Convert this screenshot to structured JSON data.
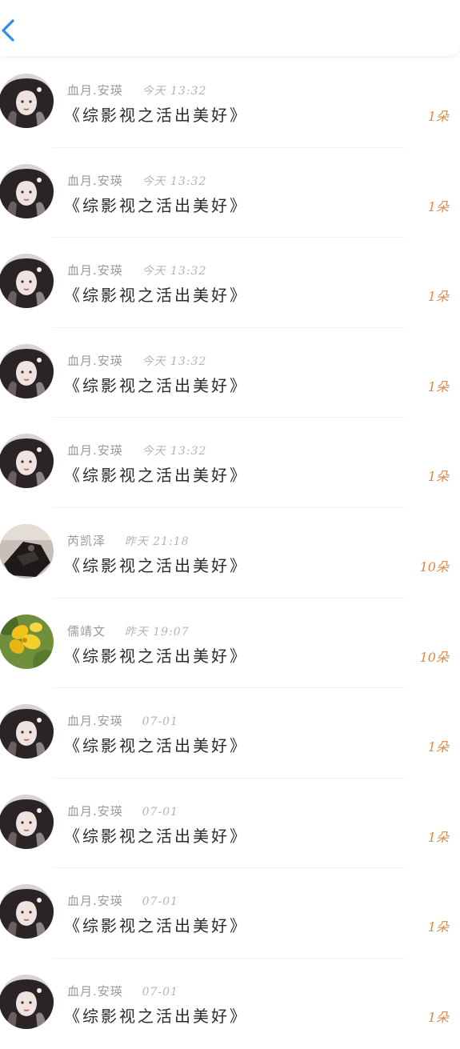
{
  "header": {
    "back_icon": "chevron-left-icon",
    "accent": "#2d8cf0"
  },
  "colors": {
    "count": "#d98a4a",
    "title": "#2b2b2b",
    "meta": "#9a9a9a"
  },
  "rows": [
    {
      "user": "血月.安瑛",
      "time": "今天 13:32",
      "title": "《综影视之活出美好》",
      "count": "1朵",
      "avatar": "dark-hair-girl"
    },
    {
      "user": "血月.安瑛",
      "time": "今天 13:32",
      "title": "《综影视之活出美好》",
      "count": "1朵",
      "avatar": "dark-hair-girl"
    },
    {
      "user": "血月.安瑛",
      "time": "今天 13:32",
      "title": "《综影视之活出美好》",
      "count": "1朵",
      "avatar": "dark-hair-girl"
    },
    {
      "user": "血月.安瑛",
      "time": "今天 13:32",
      "title": "《综影视之活出美好》",
      "count": "1朵",
      "avatar": "dark-hair-girl"
    },
    {
      "user": "血月.安瑛",
      "time": "今天 13:32",
      "title": "《综影视之活出美好》",
      "count": "1朵",
      "avatar": "dark-hair-girl"
    },
    {
      "user": "芮凯泽",
      "time": "昨天 21:18",
      "title": "《综影视之活出美好》",
      "count": "10朵",
      "avatar": "dark-figure"
    },
    {
      "user": "儒靖文",
      "time": "昨天 19:07",
      "title": "《综影视之活出美好》",
      "count": "10朵",
      "avatar": "yellow-flower"
    },
    {
      "user": "血月.安瑛",
      "time": "07-01",
      "title": "《综影视之活出美好》",
      "count": "1朵",
      "avatar": "dark-hair-girl"
    },
    {
      "user": "血月.安瑛",
      "time": "07-01",
      "title": "《综影视之活出美好》",
      "count": "1朵",
      "avatar": "dark-hair-girl"
    },
    {
      "user": "血月.安瑛",
      "time": "07-01",
      "title": "《综影视之活出美好》",
      "count": "1朵",
      "avatar": "dark-hair-girl"
    },
    {
      "user": "血月.安瑛",
      "time": "07-01",
      "title": "《综影视之活出美好》",
      "count": "1朵",
      "avatar": "dark-hair-girl"
    }
  ]
}
